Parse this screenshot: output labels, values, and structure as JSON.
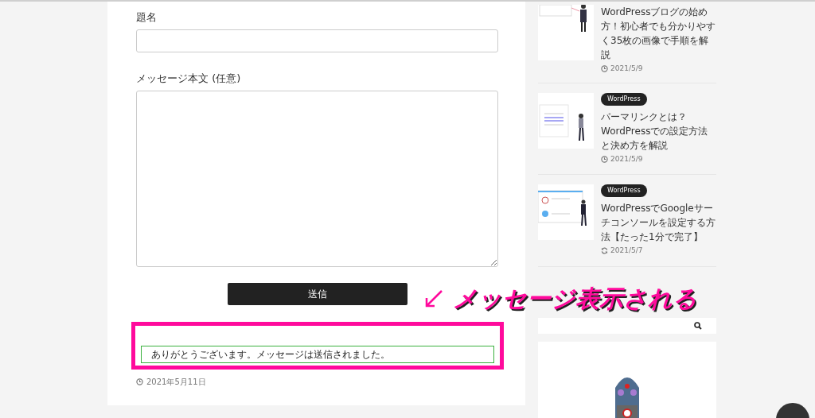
{
  "form": {
    "fields": [
      {
        "label": "題名",
        "kind": "input"
      },
      {
        "label": "メッセージ本文 (任意)",
        "kind": "textarea"
      }
    ],
    "submit": "送信",
    "success_message": "ありがとうございます。メッセージは送信されました。",
    "date": "2021年5月11日"
  },
  "sidebar": {
    "posts": [
      {
        "title": "WordPressブログの始め方！初心者でも分かりやすく35枚の画像で手順を解説",
        "date": "2021/5/9",
        "kind": "published"
      },
      {
        "category": "WordPress",
        "title": "パーマリンクとは？WordPressでの設定方法と決め方を解説",
        "date": "2021/5/9",
        "kind": "published"
      },
      {
        "category": "WordPress",
        "title": "WordPressでGoogleサーチコンソールを設定する方法【たった1分で完了】",
        "date": "2021/5/7",
        "kind": "updated"
      }
    ]
  },
  "annotation": {
    "text": "メッセージ表示される"
  }
}
